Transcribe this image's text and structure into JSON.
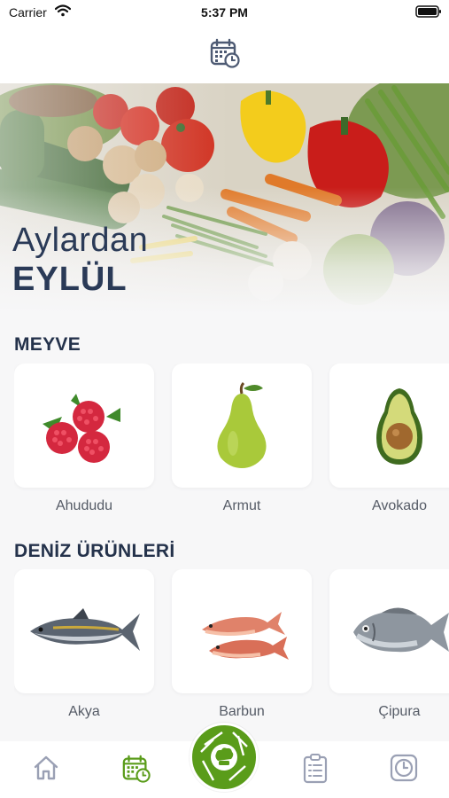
{
  "status_bar": {
    "carrier": "Carrier",
    "time": "5:37 PM"
  },
  "hero": {
    "subtitle": "Aylardan",
    "title": "EYLÜL"
  },
  "sections": [
    {
      "title": "MEYVE",
      "items": [
        {
          "label": "Ahududu",
          "icon": "raspberry-icon"
        },
        {
          "label": "Armut",
          "icon": "pear-icon"
        },
        {
          "label": "Avokado",
          "icon": "avocado-icon"
        }
      ]
    },
    {
      "title": "DENİZ ÜRÜNLERİ",
      "items": [
        {
          "label": "Akya",
          "icon": "fish-icon"
        },
        {
          "label": "Barbun",
          "icon": "red-mullet-icon"
        },
        {
          "label": "Çipura",
          "icon": "sea-bream-icon"
        }
      ]
    }
  ],
  "bottom_nav": {
    "items": [
      "home-icon",
      "calendar-icon",
      "chef-icon",
      "checklist-icon",
      "clock-icon"
    ],
    "active": "calendar-icon",
    "accent": "#5a9c1a",
    "inactive": "#9aa0b4"
  },
  "colors": {
    "heading": "#24324b",
    "accent": "#5a9c1a"
  }
}
